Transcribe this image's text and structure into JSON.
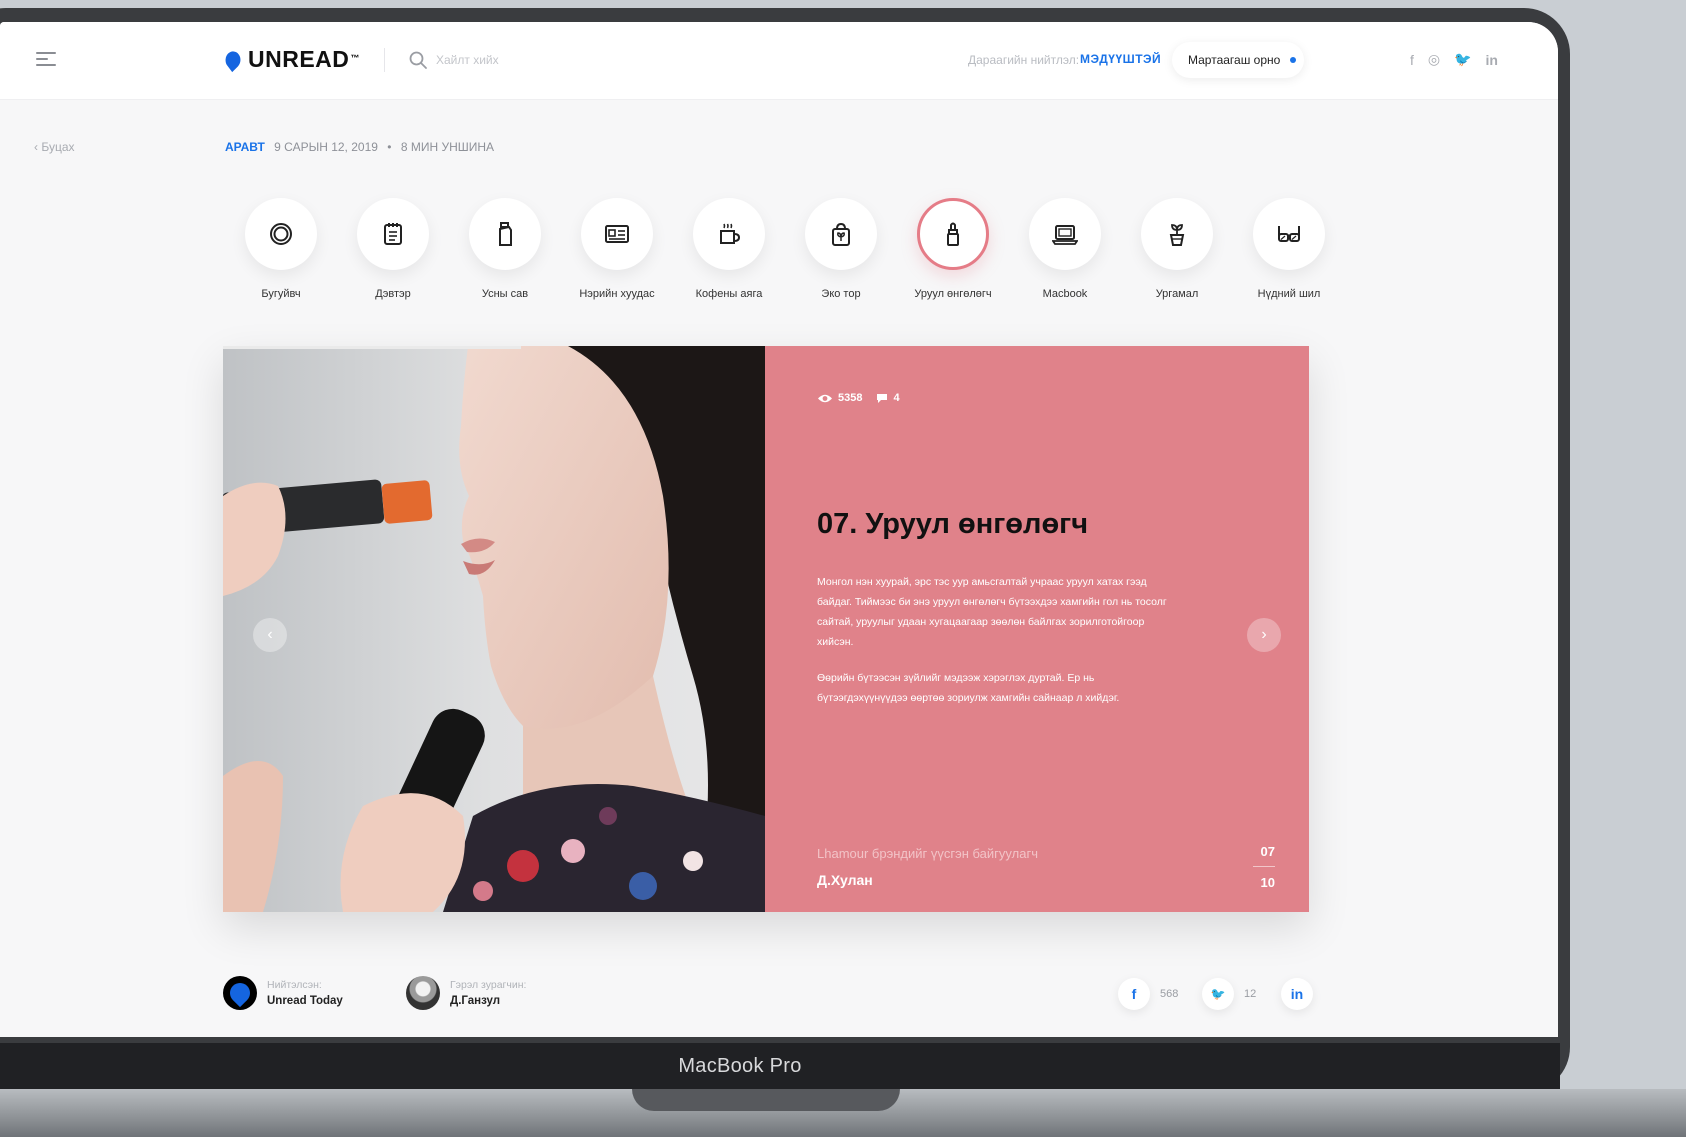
{
  "header": {
    "logo_text": "UNREAD",
    "logo_tm": "™",
    "search_placeholder": "Хайлт хийх",
    "next_label": "Дараагийн нийтлэл:",
    "next_link": "МЭДҮҮШТЭЙ",
    "toggle_label": "Мартаагаш орно",
    "social": [
      "f",
      "◎",
      "🐦",
      "in"
    ]
  },
  "breadcrumb": {
    "back_label": "‹  Буцах",
    "author": "АРАВТ",
    "date": "9 САРЫН 12, 2019",
    "separator": "•",
    "read_time": "8 МИН УНШИНА"
  },
  "categories": [
    {
      "label": "Бугуйвч",
      "icon": "ring-icon",
      "active": false
    },
    {
      "label": "Дэвтэр",
      "icon": "notebook-icon",
      "active": false
    },
    {
      "label": "Усны сав",
      "icon": "water-bottle-icon",
      "active": false
    },
    {
      "label": "Нэрийн хуудас",
      "icon": "business-card-icon",
      "active": false
    },
    {
      "label": "Кофены аяга",
      "icon": "coffee-cup-icon",
      "active": false
    },
    {
      "label": "Эко тор",
      "icon": "eco-bag-icon",
      "active": false
    },
    {
      "label": "Уруул өнгөлөгч",
      "icon": "lip-balm-icon",
      "active": true
    },
    {
      "label": "Macbook",
      "icon": "laptop-icon",
      "active": false
    },
    {
      "label": "Ургамал",
      "icon": "plant-icon",
      "active": false
    },
    {
      "label": "Нүдний шил",
      "icon": "glasses-icon",
      "active": false
    }
  ],
  "slide": {
    "progress": 0.55,
    "views": "5358",
    "comments": "4",
    "title": "07.  Уруул өнгөлөгч",
    "paragraphs": [
      "Монгол нэн хуурай, эрс тэс уур амьсгалтай учраас уруул хатах гээд байдаг. Тиймээс би энэ уруул өнгөлөгч бүтээхдээ хамгийн гол нь тосолг сайтай, уруулыг удаан хугацаагаар зөөлөн байлгах зорилготойгоор хийсэн.",
      "Өөрийн бүтээсэн зүйлийг мэдээж хэрэглэх дуртай. Ер нь бүтээгдэхүүнүүдээ өөртөө зориулж хамгийн сайнаар л хийдэг."
    ],
    "author_role": "Lhamour брэндийг үүсгэн байгуулагч",
    "author_name": "Д.Хулан",
    "current": "07",
    "total": "10"
  },
  "footer": {
    "publisher_label": "Нийтэлсэн:",
    "publisher": "Unread Today",
    "photographer_label": "Гэрэл зурагчин:",
    "photographer": "Д.Ганзул",
    "shares": [
      {
        "network": "facebook",
        "glyph": "f",
        "count": "568",
        "color": "#1a73e8"
      },
      {
        "network": "twitter",
        "glyph": "🐦",
        "count": "12",
        "color": "#1a73e8"
      },
      {
        "network": "linkedin",
        "glyph": "in",
        "count": "",
        "color": "#1a73e8"
      }
    ]
  },
  "device_label": "MacBook Pro",
  "colors": {
    "accent": "#1a73e8",
    "panel": "#e0828a",
    "active_ring": "#e57c87"
  }
}
